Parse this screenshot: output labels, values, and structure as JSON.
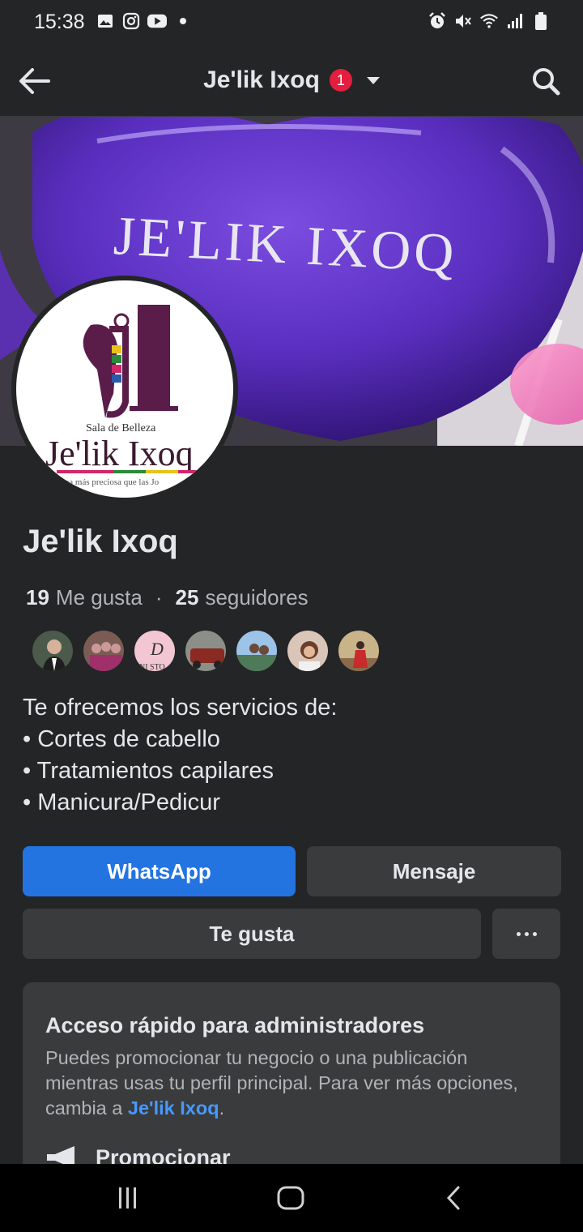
{
  "status_bar": {
    "time": "15:38",
    "left_icons": [
      "gallery-icon",
      "instagram-icon",
      "youtube-icon",
      "dot-icon"
    ],
    "right_icons": [
      "alarm-icon",
      "mute-icon",
      "wifi-icon",
      "signal-icon",
      "battery-icon"
    ]
  },
  "header": {
    "title": "Je'lik Ixoq",
    "notification_count": "1",
    "back_icon": "arrow-left-icon",
    "search_icon": "search-icon"
  },
  "cover": {
    "balloon_text": "JE'LIK IXOQ"
  },
  "avatar": {
    "logo_subtitle": "Sala de Belleza",
    "logo_name": "Je'lik Ixoq",
    "logo_tagline": "uosa más preciosa que las Jo"
  },
  "profile": {
    "name": "Je'lik Ixoq",
    "likes_count": "19",
    "likes_label": "Me gusta",
    "separator": "·",
    "followers_count": "25",
    "followers_label": "seguidores",
    "description": "Te ofrecemos los servicios de:\n• Cortes de cabello\n• Tratamientos capilares\n• Manicura/Pedicur"
  },
  "friends": [
    {
      "name": "friend-1"
    },
    {
      "name": "friend-2"
    },
    {
      "name": "friend-3",
      "label": "NI STO"
    },
    {
      "name": "friend-4"
    },
    {
      "name": "friend-5"
    },
    {
      "name": "friend-6"
    },
    {
      "name": "friend-7"
    }
  ],
  "actions": {
    "whatsapp_label": "WhatsApp",
    "message_label": "Mensaje",
    "like_label": "Te gusta",
    "more_icon": "more-icon"
  },
  "admin": {
    "title": "Acceso rápido para administradores",
    "text_before": "Puedes promocionar tu negocio o una publicación mientras usas tu perfil principal. Para ver más opciones, cambia a ",
    "link": "Je'lik Ixoq",
    "text_after": ".",
    "promote_label": "Promocionar"
  },
  "colors": {
    "background": "#242526",
    "primary_button": "#2374e1",
    "secondary_button": "#3a3b3c",
    "link": "#4599ff",
    "badge": "#e41e3f"
  }
}
